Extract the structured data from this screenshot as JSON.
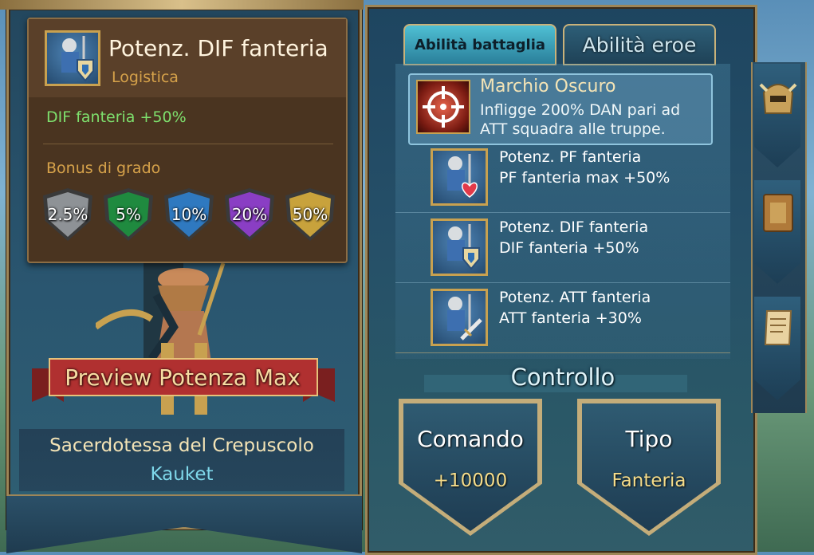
{
  "tooltip": {
    "title": "Potenz. DIF fanteria",
    "subtitle": "Logistica",
    "effect": "DIF fanteria +50%",
    "bonus_title": "Bonus di grado",
    "bonuses": [
      {
        "label": "2.5%",
        "color": "#8e9296"
      },
      {
        "label": "5%",
        "color": "#1f8a3f"
      },
      {
        "label": "10%",
        "color": "#2f79c0"
      },
      {
        "label": "20%",
        "color": "#8a3ec4"
      },
      {
        "label": "50%",
        "color": "#c8a23c"
      }
    ]
  },
  "preview_button": "Preview Potenza Max",
  "hero": {
    "name": "Sacerdotessa del Crepuscolo",
    "subname": "Kauket"
  },
  "tabs": {
    "battle": "Abilità battaglia",
    "hero": "Abilità eroe"
  },
  "main_skill": {
    "name": "Marchio Oscuro",
    "desc_line1": "Infligge 200% DAN pari ad",
    "desc_line2": "ATT squadra alle truppe."
  },
  "sub_skills": [
    {
      "name": "Potenz. PF fanteria",
      "effect": "PF fanteria max +50%",
      "icon": "heart-icon"
    },
    {
      "name": "Potenz. DIF fanteria",
      "effect": "DIF fanteria +50%",
      "icon": "shield-icon"
    },
    {
      "name": "Potenz. ATT fanteria",
      "effect": "ATT fanteria +30%",
      "icon": "sword-icon"
    }
  ],
  "control": {
    "title": "Controllo",
    "command_label": "Comando",
    "command_value": "+10000",
    "type_label": "Tipo",
    "type_value": "Fanteria"
  },
  "side_tabs": [
    "helmet-icon",
    "book-icon",
    "scroll-icon"
  ]
}
